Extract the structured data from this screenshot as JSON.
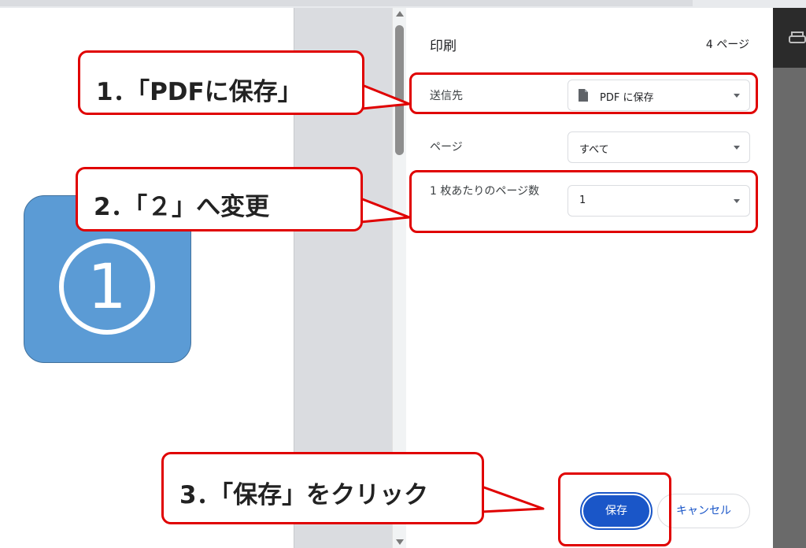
{
  "preview": {
    "tile_numeral": "1",
    "tile_color": "#5b9bd5"
  },
  "panel": {
    "title": "印刷",
    "page_count": "4 ページ",
    "destination": {
      "label": "送信先",
      "value": "PDF に保存",
      "icon": "document-icon"
    },
    "pages": {
      "label": "ページ",
      "value": "すべて"
    },
    "pages_per_sheet": {
      "label": "1 枚あたりのページ数",
      "value": "1"
    },
    "save_label": "保存",
    "cancel_label": "キャンセル",
    "accent_color": "#1a56c8"
  },
  "annotations": {
    "step1": "1．「PDFに保存」",
    "step2": "2．「２」へ変更",
    "step3": "3．「保存」をクリック",
    "highlight_color": "#e00000"
  }
}
